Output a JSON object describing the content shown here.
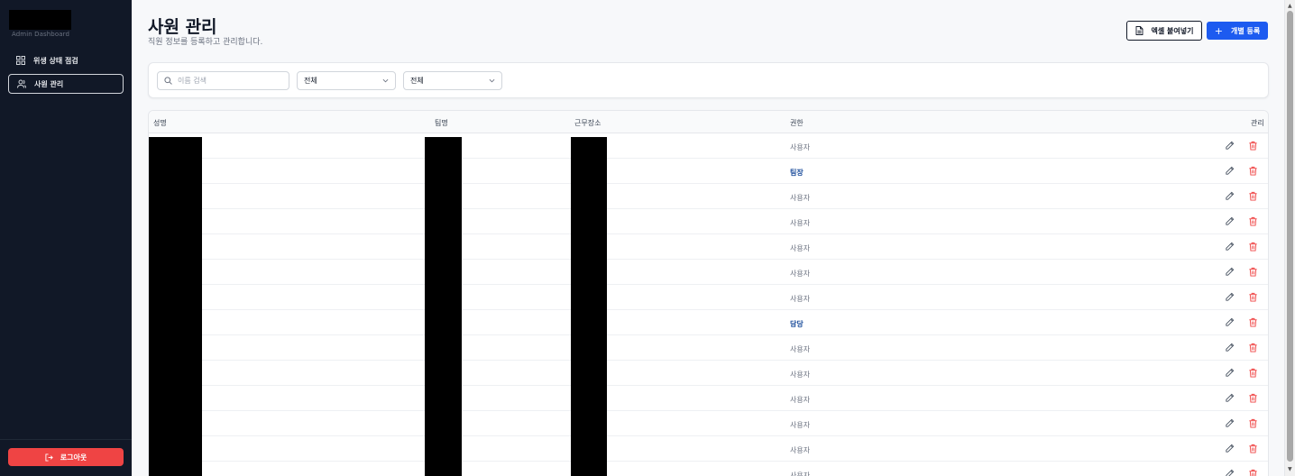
{
  "sidebar": {
    "brand_subtitle": "Admin Dashboard",
    "items": [
      {
        "label": "위생 상태 점검",
        "icon": "grid-icon"
      },
      {
        "label": "사원 관리",
        "icon": "users-icon"
      }
    ],
    "logout_label": "로그아웃"
  },
  "header": {
    "title": "사원 관리",
    "description": "직원 정보를 등록하고 관리합니다.",
    "excel_button": "엑셀 붙여넣기",
    "add_button": "개별 등록"
  },
  "filters": {
    "search_placeholder": "이름 검색",
    "team_select": "전체",
    "role_select": "전체"
  },
  "table": {
    "columns": [
      "성명",
      "팀명",
      "근무장소",
      "권한",
      "관리"
    ],
    "rows": [
      {
        "role": "사용자",
        "highlight": false
      },
      {
        "role": "팀장",
        "highlight": true
      },
      {
        "role": "사용자",
        "highlight": false
      },
      {
        "role": "사용자",
        "highlight": false
      },
      {
        "role": "사용자",
        "highlight": false
      },
      {
        "role": "사용자",
        "highlight": false
      },
      {
        "role": "사용자",
        "highlight": false
      },
      {
        "role": "담당",
        "highlight": true
      },
      {
        "role": "사용자",
        "highlight": false
      },
      {
        "role": "사용자",
        "highlight": false
      },
      {
        "role": "사용자",
        "highlight": false
      },
      {
        "role": "사용자",
        "highlight": false
      },
      {
        "role": "사용자",
        "highlight": false
      },
      {
        "role": "사용자",
        "highlight": false
      }
    ]
  },
  "colors": {
    "sidebar_bg": "#111827",
    "primary": "#1d5bf0",
    "danger": "#ef4444",
    "role_highlight": "#1e4f9c"
  }
}
